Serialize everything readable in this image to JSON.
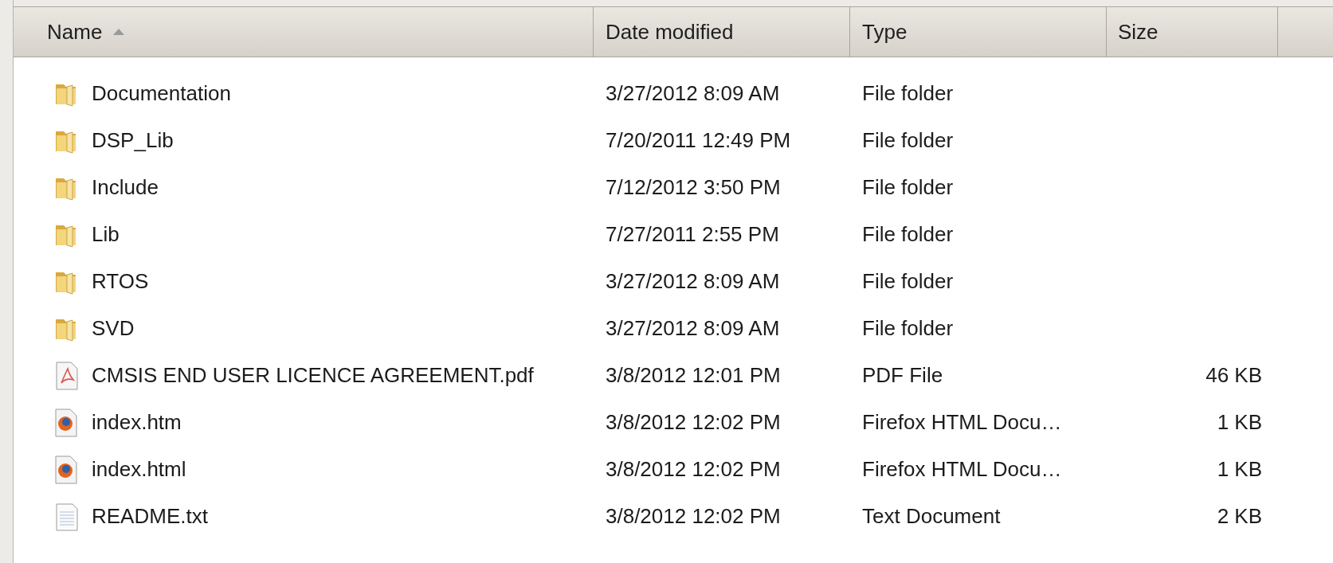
{
  "columns": [
    {
      "label": "Name",
      "sorted": true
    },
    {
      "label": "Date modified",
      "sorted": false
    },
    {
      "label": "Type",
      "sorted": false
    },
    {
      "label": "Size",
      "sorted": false
    }
  ],
  "rows": [
    {
      "kind": "folder",
      "name": "Documentation",
      "date": "3/27/2012 8:09 AM",
      "type": "File folder"
    },
    {
      "kind": "folder",
      "name": "DSP_Lib",
      "date": "7/20/2011 12:49 PM",
      "type": "File folder"
    },
    {
      "kind": "folder",
      "name": "Include",
      "date": "7/12/2012 3:50 PM",
      "type": "File folder"
    },
    {
      "kind": "folder",
      "name": "Lib",
      "date": "7/27/2011 2:55 PM",
      "type": "File folder"
    },
    {
      "kind": "folder",
      "name": "RTOS",
      "date": "3/27/2012 8:09 AM",
      "type": "File folder"
    },
    {
      "kind": "folder",
      "name": "SVD",
      "date": "3/27/2012 8:09 AM",
      "type": "File folder"
    },
    {
      "kind": "pdf",
      "name": "CMSIS END USER LICENCE AGREEMENT.pdf",
      "date": "3/8/2012 12:01 PM",
      "type": "PDF File",
      "size": "46 KB"
    },
    {
      "kind": "web",
      "name": "index.htm",
      "date": "3/8/2012 12:02 PM",
      "type": "Firefox HTML Docu…",
      "size": "1 KB"
    },
    {
      "kind": "web",
      "name": "index.html",
      "date": "3/8/2012 12:02 PM",
      "type": "Firefox HTML Docu…",
      "size": "1 KB"
    },
    {
      "kind": "text",
      "name": "README.txt",
      "date": "3/8/2012 12:02 PM",
      "type": "Text Document",
      "size": "2 KB"
    }
  ]
}
